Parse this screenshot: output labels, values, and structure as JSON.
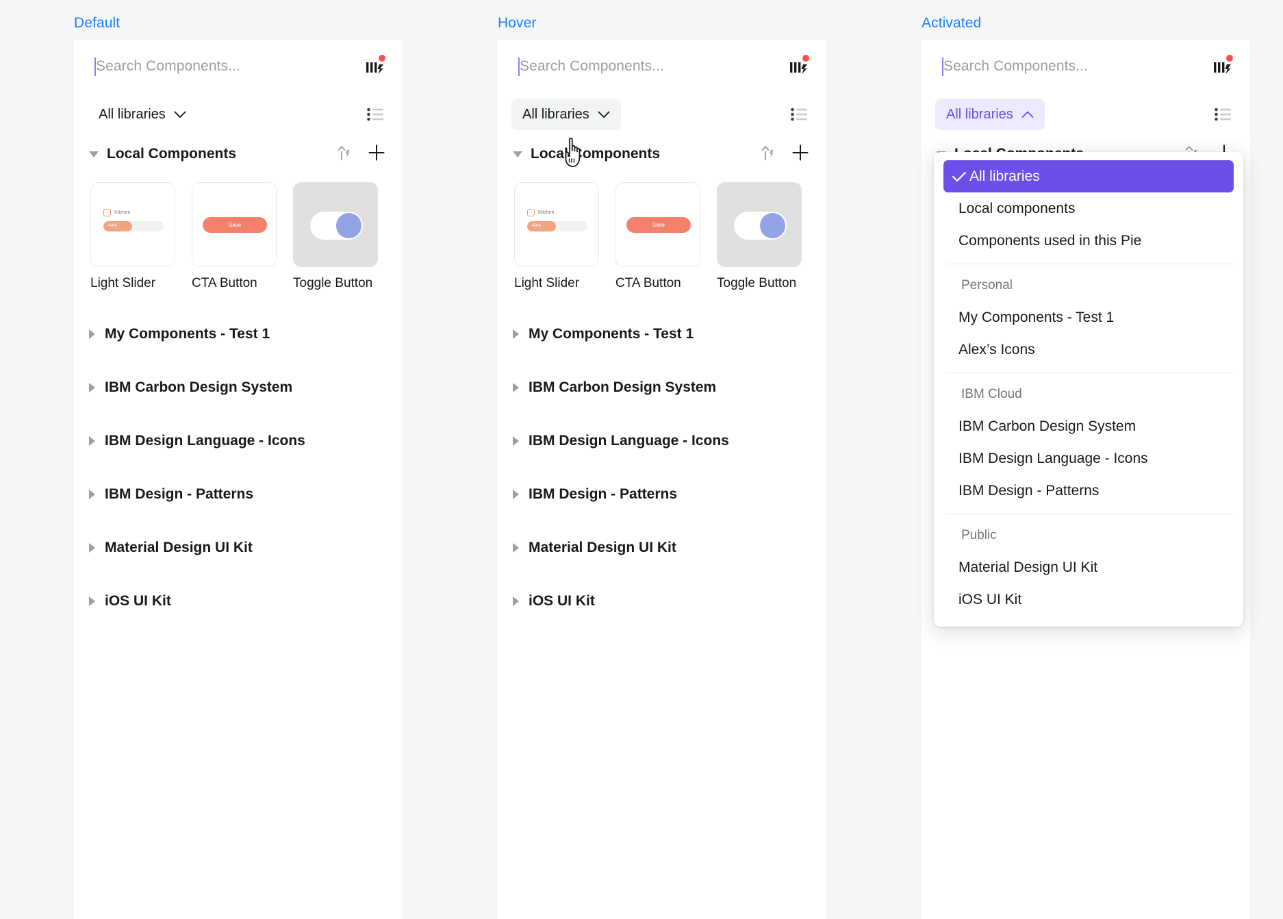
{
  "columns": [
    {
      "label": "Default",
      "state": "default"
    },
    {
      "label": "Hover",
      "state": "hover"
    },
    {
      "label": "Activated",
      "state": "activated"
    }
  ],
  "colors": {
    "label_blue": "#1a82ff",
    "accent_purple": "#6c4fe8",
    "accent_purple_soft": "#eceaff",
    "hover_gray": "#f2f3f5",
    "page_bg": "#f5f6f8",
    "panel_bg": "#ffffff",
    "notification_red": "#ff4d4d",
    "cta_coral": "#f4816e",
    "slider_orange": "#f0a47f",
    "toggle_knob": "#93a3e8"
  },
  "search": {
    "placeholder": "Search Components...",
    "value": "",
    "bolt_icon": "library-bolt-icon",
    "badge": true
  },
  "toolbar": {
    "library_filter_label": "All libraries",
    "chevron_down_icon": "chevron-down-icon",
    "chevron_up_icon": "chevron-up-icon",
    "list_view_icon": "list-view-icon"
  },
  "section": {
    "title": "Local Components",
    "expanded": true,
    "publish_icon": "publish-bolt-icon",
    "add_icon": "plus-icon"
  },
  "components": [
    {
      "label": "Light Slider",
      "art": "slider",
      "slider_name": "Kitchen",
      "slider_percent": "48%",
      "background": "white"
    },
    {
      "label": "CTA Button",
      "art": "cta",
      "button_text": "Save",
      "background": "white"
    },
    {
      "label": "Toggle Button",
      "art": "toggle",
      "background": "gray"
    }
  ],
  "libraries": [
    {
      "name": "My Components - Test 1",
      "expanded": false
    },
    {
      "name": "IBM Carbon Design System",
      "expanded": false
    },
    {
      "name": "IBM Design Language - Icons",
      "expanded": false
    },
    {
      "name": "IBM Design - Patterns",
      "expanded": false
    },
    {
      "name": "Material Design UI Kit",
      "expanded": false
    },
    {
      "name": "iOS UI Kit",
      "expanded": false
    }
  ],
  "dropdown": {
    "items": [
      {
        "type": "item",
        "label": "All libraries",
        "selected": true
      },
      {
        "type": "item",
        "label": "Local components",
        "selected": false
      },
      {
        "type": "item",
        "label": "Components used in this Pie",
        "selected": false
      },
      {
        "type": "separator"
      },
      {
        "type": "group",
        "label": "Personal"
      },
      {
        "type": "item",
        "label": "My Components - Test 1",
        "selected": false
      },
      {
        "type": "item",
        "label": "Alex’s Icons",
        "selected": false
      },
      {
        "type": "separator"
      },
      {
        "type": "group",
        "label": "IBM Cloud"
      },
      {
        "type": "item",
        "label": "IBM Carbon Design System",
        "selected": false
      },
      {
        "type": "item",
        "label": "IBM Design Language - Icons",
        "selected": false
      },
      {
        "type": "item",
        "label": "IBM Design - Patterns",
        "selected": false
      },
      {
        "type": "separator"
      },
      {
        "type": "group",
        "label": "Public"
      },
      {
        "type": "item",
        "label": "Material Design UI Kit",
        "selected": false
      },
      {
        "type": "item",
        "label": "iOS UI Kit",
        "selected": false
      }
    ],
    "check_icon": "check-icon"
  },
  "cursor": {
    "icon": "pointing-hand-cursor"
  }
}
